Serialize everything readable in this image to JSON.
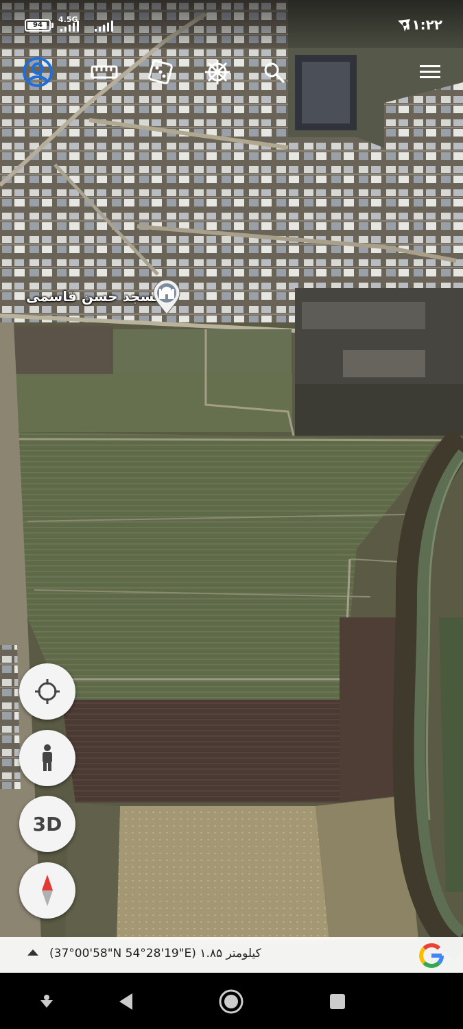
{
  "status_bar": {
    "battery_level": "94",
    "battery_fraction": 0.94,
    "network_type": "4.5G",
    "time": "۱۱:۲۲"
  },
  "toolbar": {
    "items": [
      {
        "name": "profile-icon"
      },
      {
        "name": "ruler-icon"
      },
      {
        "name": "dice-icon"
      },
      {
        "name": "ship-wheel-icon"
      },
      {
        "name": "search-icon"
      },
      {
        "name": "menu-icon"
      }
    ],
    "accent": "#1e6fd9"
  },
  "map": {
    "poi_label": "مسجد حسن قاسمی",
    "poi_icon": "mosque-pin-icon"
  },
  "fabs": {
    "locate": "crosshair-icon",
    "street_view": "person-icon",
    "three_d_label": "3D",
    "compass": "compass-icon"
  },
  "info_bar": {
    "coordinates_text": "(37°00'58\"N 54°28'19\"E) ۱.۸۵ کیلومتر"
  },
  "colors": {
    "field_green": "#5d6848",
    "field_brown": "#4a3b33",
    "google_red": "#ea4335",
    "google_blue": "#4285f4",
    "google_yellow": "#fbbc05",
    "google_green": "#34a853"
  }
}
